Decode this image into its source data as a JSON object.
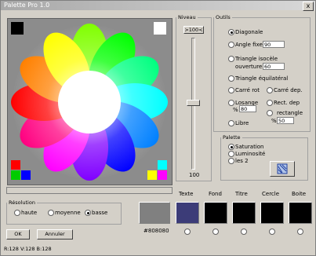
{
  "window": {
    "title": "Palette Pro 1.0",
    "close_label": "x"
  },
  "status": "R:128 V:128 B:128",
  "niveau": {
    "legend": "Niveau",
    "top_button": ">100<",
    "value": 100,
    "max": 100,
    "bottom_label": "100"
  },
  "outils": {
    "legend": "Outils",
    "options": {
      "diagonale": "Diagonale",
      "angle_fixe": "Angle fixe",
      "angle_fixe_value": "90",
      "triangle_isocele_1": "Triangle isocèle",
      "triangle_isocele_2": "ouverture",
      "triangle_isocele_value": "60",
      "triangle_equilateral": "Triangle équilatéral",
      "carre_rot": "Carré rot",
      "carre_dep": "Carré dep.",
      "losange": "Losange",
      "losange_pct": "%",
      "losange_value": "80",
      "rect_dep": "Rect. dep",
      "rectangle": "rectangle",
      "rectangle_pct": "%",
      "rectangle_value": "50",
      "libre": "Libre"
    }
  },
  "palette": {
    "legend": "Palette",
    "saturation": "Saturation",
    "luminosite": "Luminosité",
    "les2": "les 2"
  },
  "resolution": {
    "legend": "Résolution",
    "haute": "haute",
    "moyenne": "moyenne",
    "basse": "basse"
  },
  "buttons": {
    "ok": "OK",
    "annuler": "Annuler"
  },
  "preview": {
    "hex": "#808080",
    "color": "#808080"
  },
  "swatches": [
    {
      "label": "Texte",
      "color": "#3c3c78",
      "selected": false
    },
    {
      "label": "Fond",
      "color": "#000000",
      "selected": false
    },
    {
      "label": "Titre",
      "color": "#000000",
      "selected": false
    },
    {
      "label": "Cercle",
      "color": "#000000",
      "selected": false
    },
    {
      "label": "Boite",
      "color": "#000000",
      "selected": false
    }
  ],
  "colors": {
    "background": "#d4d0c8",
    "canvas": "#8c8c8c"
  }
}
